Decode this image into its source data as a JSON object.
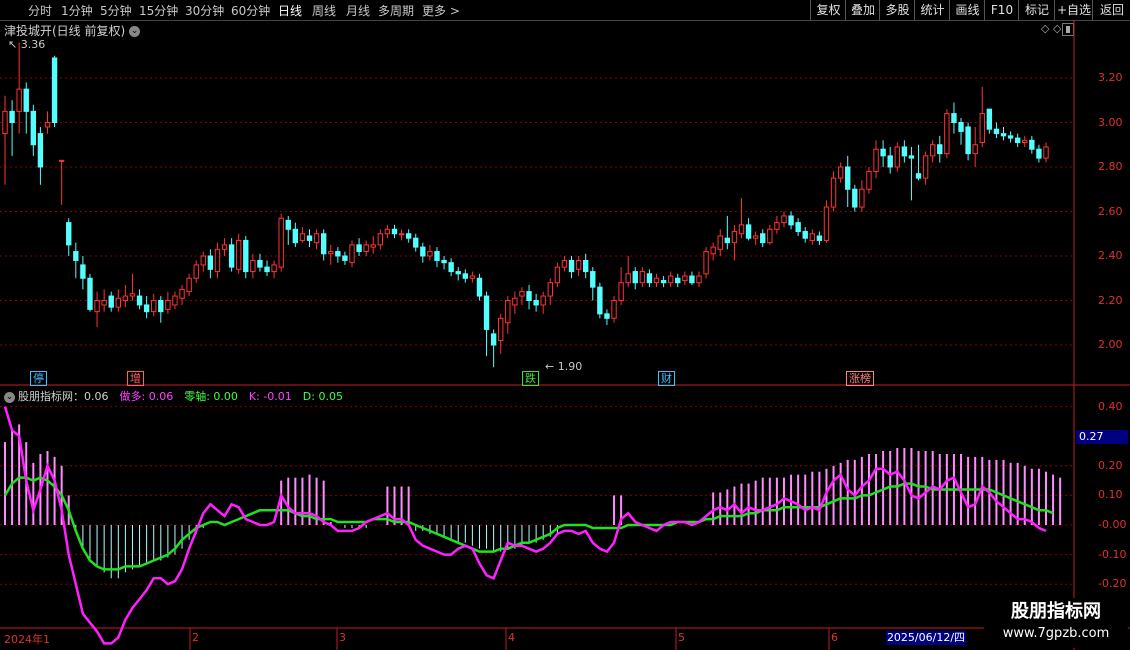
{
  "toolbar": {
    "periods": [
      "分时",
      "1分钟",
      "5分钟",
      "15分钟",
      "30分钟",
      "60分钟",
      "日线",
      "周线",
      "月线",
      "多周期",
      "更多"
    ],
    "active_index": 6,
    "more_arrow": ">",
    "buttons": [
      "复权",
      "叠加",
      "多股",
      "统计",
      "画线",
      "F10",
      "标记",
      "+自选",
      "返回"
    ]
  },
  "chart_title": "津投城开(日线 前复权)",
  "chevron": "⌄",
  "title_icons": "◇ ◇",
  "price_axis": [
    "3.20",
    "3.00",
    "2.80",
    "2.60",
    "2.40",
    "2.20",
    "2.00"
  ],
  "high_label": "3.36",
  "low_label": "1.90",
  "markers": [
    {
      "text": "停",
      "color": "#40c0ff"
    },
    {
      "text": "增",
      "color": "#ff6060"
    },
    {
      "text": "跌",
      "color": "#40e040"
    },
    {
      "text": "财",
      "color": "#40c0ff"
    },
    {
      "text": "涨榜",
      "color": "#ff8080"
    }
  ],
  "indicator": {
    "name": "股朋指标网：0.06",
    "items": [
      {
        "label": "做多: 0.06",
        "color": "#ff40ff"
      },
      {
        "label": "零轴: 0.00",
        "color": "#40ff40"
      },
      {
        "label": "K: -0.01",
        "color": "#ff40ff"
      },
      {
        "label": "D: 0.05",
        "color": "#40ff40"
      }
    ],
    "axis": [
      "0.40",
      "0.20",
      "0.10",
      "-0.00",
      "-0.10",
      "-0.20"
    ],
    "current": "0.27"
  },
  "months": [
    "2024年1",
    "2",
    "3",
    "4",
    "5",
    "6"
  ],
  "current_date": "2025/06/12/四",
  "watermark": {
    "line1": "股朋指标网",
    "line2": "www.7gpzb.com"
  },
  "colors": {
    "up": "#ff3232",
    "down": "#54ffff",
    "grid": "#8b0000",
    "k_line": "#ff20ff",
    "d_line": "#20e020"
  },
  "chart_data": {
    "type": "candlestick",
    "candles": [
      [
        2.95,
        3.05,
        3.12,
        2.72
      ],
      [
        3.05,
        3.0,
        3.1,
        2.85
      ],
      [
        3.05,
        3.15,
        3.36,
        2.95
      ],
      [
        3.15,
        3.05,
        3.18,
        2.95
      ],
      [
        3.05,
        2.9,
        3.08,
        2.85
      ],
      [
        2.95,
        2.8,
        2.98,
        2.72
      ],
      [
        2.98,
        3.0,
        3.05,
        2.95
      ],
      [
        3.29,
        3.0,
        3.3,
        2.98
      ],
      [
        2.83,
        2.83,
        2.83,
        2.63
      ],
      [
        2.55,
        2.45,
        2.57,
        2.4
      ],
      [
        2.42,
        2.38,
        2.46,
        2.3
      ],
      [
        2.36,
        2.3,
        2.4,
        2.25
      ],
      [
        2.3,
        2.16,
        2.32,
        2.15
      ],
      [
        2.15,
        2.2,
        2.24,
        2.08
      ],
      [
        2.18,
        2.2,
        2.25,
        2.15
      ],
      [
        2.22,
        2.17,
        2.24,
        2.15
      ],
      [
        2.17,
        2.21,
        2.25,
        2.15
      ],
      [
        2.2,
        2.22,
        2.27,
        2.17
      ],
      [
        2.22,
        2.23,
        2.32,
        2.2
      ],
      [
        2.22,
        2.18,
        2.25,
        2.16
      ],
      [
        2.18,
        2.15,
        2.22,
        2.12
      ],
      [
        2.15,
        2.2,
        2.23,
        2.13
      ],
      [
        2.2,
        2.15,
        2.22,
        2.1
      ],
      [
        2.16,
        2.2,
        2.24,
        2.14
      ],
      [
        2.18,
        2.22,
        2.24,
        2.16
      ],
      [
        2.21,
        2.25,
        2.27,
        2.18
      ],
      [
        2.24,
        2.3,
        2.32,
        2.22
      ],
      [
        2.3,
        2.36,
        2.38,
        2.28
      ],
      [
        2.36,
        2.4,
        2.42,
        2.33
      ],
      [
        2.4,
        2.34,
        2.43,
        2.3
      ],
      [
        2.33,
        2.43,
        2.46,
        2.3
      ],
      [
        2.43,
        2.45,
        2.48,
        2.4
      ],
      [
        2.45,
        2.35,
        2.48,
        2.33
      ],
      [
        2.34,
        2.47,
        2.5,
        2.32
      ],
      [
        2.47,
        2.33,
        2.49,
        2.3
      ],
      [
        2.33,
        2.38,
        2.41,
        2.3
      ],
      [
        2.38,
        2.35,
        2.41,
        2.33
      ],
      [
        2.35,
        2.33,
        2.38,
        2.31
      ],
      [
        2.33,
        2.36,
        2.38,
        2.3
      ],
      [
        2.35,
        2.57,
        2.59,
        2.33
      ],
      [
        2.56,
        2.52,
        2.58,
        2.45
      ],
      [
        2.52,
        2.46,
        2.55,
        2.44
      ],
      [
        2.47,
        2.5,
        2.53,
        2.46
      ],
      [
        2.49,
        2.47,
        2.52,
        2.44
      ],
      [
        2.46,
        2.5,
        2.52,
        2.43
      ],
      [
        2.5,
        2.41,
        2.52,
        2.38
      ],
      [
        2.41,
        2.42,
        2.45,
        2.36
      ],
      [
        2.42,
        2.4,
        2.44,
        2.37
      ],
      [
        2.4,
        2.38,
        2.42,
        2.36
      ],
      [
        2.37,
        2.45,
        2.47,
        2.35
      ],
      [
        2.45,
        2.42,
        2.48,
        2.4
      ],
      [
        2.42,
        2.45,
        2.47,
        2.4
      ],
      [
        2.44,
        2.45,
        2.49,
        2.41
      ],
      [
        2.45,
        2.5,
        2.52,
        2.43
      ],
      [
        2.5,
        2.52,
        2.54,
        2.48
      ],
      [
        2.52,
        2.5,
        2.54,
        2.48
      ],
      [
        2.5,
        2.5,
        2.52,
        2.47
      ],
      [
        2.5,
        2.48,
        2.52,
        2.46
      ],
      [
        2.48,
        2.44,
        2.5,
        2.42
      ],
      [
        2.44,
        2.4,
        2.46,
        2.37
      ],
      [
        2.4,
        2.42,
        2.45,
        2.38
      ],
      [
        2.42,
        2.38,
        2.44,
        2.35
      ],
      [
        2.38,
        2.37,
        2.4,
        2.34
      ],
      [
        2.37,
        2.33,
        2.39,
        2.31
      ],
      [
        2.33,
        2.32,
        2.35,
        2.29
      ],
      [
        2.32,
        2.3,
        2.34,
        2.28
      ],
      [
        2.3,
        2.31,
        2.33,
        2.28
      ],
      [
        2.3,
        2.22,
        2.32,
        2.2
      ],
      [
        2.22,
        2.07,
        2.24,
        1.95
      ],
      [
        2.05,
        2.0,
        2.07,
        1.9
      ],
      [
        2.02,
        2.12,
        2.14,
        1.96
      ],
      [
        2.1,
        2.2,
        2.22,
        2.05
      ],
      [
        2.18,
        2.21,
        2.24,
        2.14
      ],
      [
        2.22,
        2.24,
        2.26,
        2.18
      ],
      [
        2.24,
        2.2,
        2.27,
        2.16
      ],
      [
        2.2,
        2.18,
        2.23,
        2.15
      ],
      [
        2.18,
        2.22,
        2.24,
        2.14
      ],
      [
        2.22,
        2.28,
        2.3,
        2.18
      ],
      [
        2.28,
        2.35,
        2.37,
        2.26
      ],
      [
        2.35,
        2.38,
        2.4,
        2.33
      ],
      [
        2.38,
        2.33,
        2.4,
        2.3
      ],
      [
        2.34,
        2.38,
        2.4,
        2.31
      ],
      [
        2.38,
        2.33,
        2.41,
        2.3
      ],
      [
        2.33,
        2.26,
        2.35,
        2.2
      ],
      [
        2.26,
        2.14,
        2.28,
        2.12
      ],
      [
        2.14,
        2.12,
        2.16,
        2.09
      ],
      [
        2.12,
        2.2,
        2.22,
        2.1
      ],
      [
        2.2,
        2.28,
        2.35,
        2.18
      ],
      [
        2.28,
        2.32,
        2.4,
        2.26
      ],
      [
        2.33,
        2.28,
        2.35,
        2.25
      ],
      [
        2.28,
        2.33,
        2.35,
        2.26
      ],
      [
        2.32,
        2.28,
        2.34,
        2.26
      ],
      [
        2.28,
        2.3,
        2.32,
        2.26
      ],
      [
        2.29,
        2.28,
        2.31,
        2.26
      ],
      [
        2.28,
        2.31,
        2.33,
        2.26
      ],
      [
        2.3,
        2.28,
        2.32,
        2.26
      ],
      [
        2.29,
        2.31,
        2.33,
        2.27
      ],
      [
        2.31,
        2.28,
        2.33,
        2.27
      ],
      [
        2.28,
        2.31,
        2.33,
        2.26
      ],
      [
        2.32,
        2.42,
        2.44,
        2.3
      ],
      [
        2.41,
        2.44,
        2.46,
        2.38
      ],
      [
        2.43,
        2.49,
        2.52,
        2.4
      ],
      [
        2.48,
        2.46,
        2.58,
        2.43
      ],
      [
        2.46,
        2.51,
        2.54,
        2.38
      ],
      [
        2.5,
        2.54,
        2.66,
        2.48
      ],
      [
        2.54,
        2.48,
        2.57,
        2.47
      ],
      [
        2.48,
        2.49,
        2.51,
        2.45
      ],
      [
        2.5,
        2.46,
        2.52,
        2.44
      ],
      [
        2.46,
        2.52,
        2.54,
        2.45
      ],
      [
        2.52,
        2.55,
        2.58,
        2.5
      ],
      [
        2.55,
        2.58,
        2.6,
        2.53
      ],
      [
        2.58,
        2.54,
        2.6,
        2.52
      ],
      [
        2.55,
        2.51,
        2.57,
        2.49
      ],
      [
        2.51,
        2.48,
        2.53,
        2.46
      ],
      [
        2.47,
        2.5,
        2.52,
        2.45
      ],
      [
        2.49,
        2.47,
        2.51,
        2.45
      ],
      [
        2.47,
        2.62,
        2.65,
        2.46
      ],
      [
        2.62,
        2.75,
        2.78,
        2.6
      ],
      [
        2.75,
        2.8,
        2.82,
        2.73
      ],
      [
        2.8,
        2.7,
        2.85,
        2.62
      ],
      [
        2.7,
        2.62,
        2.72,
        2.6
      ],
      [
        2.62,
        2.7,
        2.74,
        2.6
      ],
      [
        2.7,
        2.78,
        2.8,
        2.68
      ],
      [
        2.78,
        2.88,
        2.92,
        2.75
      ],
      [
        2.88,
        2.85,
        2.92,
        2.8
      ],
      [
        2.85,
        2.8,
        2.89,
        2.77
      ],
      [
        2.8,
        2.89,
        2.91,
        2.78
      ],
      [
        2.89,
        2.85,
        2.92,
        2.82
      ],
      [
        2.85,
        2.84,
        2.89,
        2.65
      ],
      [
        2.77,
        2.75,
        2.9,
        2.74
      ],
      [
        2.75,
        2.85,
        2.87,
        2.72
      ],
      [
        2.85,
        2.9,
        2.92,
        2.82
      ],
      [
        2.9,
        2.86,
        2.94,
        2.82
      ],
      [
        2.86,
        3.04,
        3.06,
        2.84
      ],
      [
        3.04,
        3.0,
        3.09,
        2.95
      ],
      [
        3.0,
        2.96,
        3.02,
        2.9
      ],
      [
        2.98,
        2.86,
        3.0,
        2.83
      ],
      [
        2.86,
        2.9,
        2.98,
        2.8
      ],
      [
        2.91,
        3.04,
        3.16,
        2.89
      ],
      [
        3.06,
        2.97,
        3.06,
        2.95
      ],
      [
        2.97,
        2.95,
        3.0,
        2.93
      ],
      [
        2.95,
        2.94,
        2.98,
        2.92
      ],
      [
        2.94,
        2.93,
        2.96,
        2.91
      ],
      [
        2.93,
        2.91,
        2.95,
        2.89
      ],
      [
        2.91,
        2.92,
        2.94,
        2.89
      ],
      [
        2.92,
        2.88,
        2.94,
        2.86
      ],
      [
        2.88,
        2.84,
        2.9,
        2.82
      ],
      [
        2.84,
        2.89,
        2.91,
        2.82
      ]
    ],
    "k_line": [
      0.4,
      0.32,
      0.3,
      0.15,
      0.05,
      0.12,
      0.2,
      0.15,
      0.05,
      -0.1,
      -0.2,
      -0.3,
      -0.33,
      -0.36,
      -0.4,
      -0.4,
      -0.38,
      -0.32,
      -0.28,
      -0.25,
      -0.22,
      -0.18,
      -0.18,
      -0.2,
      -0.19,
      -0.15,
      -0.08,
      -0.02,
      0.04,
      0.07,
      0.05,
      0.03,
      0.07,
      0.06,
      0.02,
      0.01,
      0.0,
      0.0,
      0.01,
      0.1,
      0.06,
      0.04,
      0.04,
      0.04,
      0.03,
      0.01,
      0.0,
      -0.02,
      -0.02,
      -0.02,
      -0.01,
      0.01,
      0.02,
      0.03,
      0.04,
      0.02,
      0.02,
      0.0,
      -0.05,
      -0.07,
      -0.08,
      -0.09,
      -0.1,
      -0.1,
      -0.08,
      -0.07,
      -0.08,
      -0.13,
      -0.17,
      -0.18,
      -0.12,
      -0.06,
      -0.07,
      -0.07,
      -0.08,
      -0.09,
      -0.08,
      -0.06,
      -0.03,
      -0.02,
      -0.02,
      -0.03,
      -0.02,
      -0.06,
      -0.08,
      -0.09,
      -0.06,
      0.02,
      0.04,
      0.01,
      0.0,
      -0.01,
      -0.02,
      0.0,
      0.01,
      0.01,
      0.01,
      0.0,
      0.01,
      0.03,
      0.05,
      0.06,
      0.05,
      0.07,
      0.04,
      0.06,
      0.05,
      0.05,
      0.06,
      0.07,
      0.09,
      0.08,
      0.07,
      0.05,
      0.06,
      0.05,
      0.11,
      0.15,
      0.17,
      0.12,
      0.1,
      0.13,
      0.15,
      0.19,
      0.19,
      0.17,
      0.18,
      0.15,
      0.1,
      0.09,
      0.11,
      0.13,
      0.12,
      0.15,
      0.16,
      0.11,
      0.06,
      0.07,
      0.13,
      0.11,
      0.08,
      0.06,
      0.04,
      0.02,
      0.02,
      0.01,
      -0.01,
      -0.02
    ],
    "d_line": [
      0.1,
      0.14,
      0.16,
      0.16,
      0.15,
      0.16,
      0.15,
      0.13,
      0.1,
      0.05,
      -0.02,
      -0.08,
      -0.12,
      -0.14,
      -0.15,
      -0.15,
      -0.15,
      -0.14,
      -0.14,
      -0.14,
      -0.13,
      -0.12,
      -0.11,
      -0.1,
      -0.08,
      -0.05,
      -0.03,
      -0.01,
      0.0,
      0.01,
      0.01,
      0.0,
      0.01,
      0.02,
      0.03,
      0.04,
      0.05,
      0.05,
      0.05,
      0.05,
      0.05,
      0.04,
      0.03,
      0.03,
      0.02,
      0.02,
      0.02,
      0.01,
      0.01,
      0.01,
      0.01,
      0.01,
      0.02,
      0.02,
      0.02,
      0.01,
      0.01,
      0.01,
      0.0,
      -0.01,
      -0.02,
      -0.03,
      -0.04,
      -0.05,
      -0.06,
      -0.07,
      -0.08,
      -0.09,
      -0.09,
      -0.09,
      -0.08,
      -0.08,
      -0.07,
      -0.06,
      -0.06,
      -0.05,
      -0.04,
      -0.03,
      -0.01,
      0.0,
      0.0,
      0.0,
      0.0,
      -0.01,
      -0.01,
      -0.01,
      -0.01,
      -0.01,
      0.0,
      0.0,
      0.0,
      0.0,
      0.0,
      0.0,
      0.0,
      0.01,
      0.01,
      0.01,
      0.01,
      0.02,
      0.02,
      0.03,
      0.03,
      0.03,
      0.03,
      0.04,
      0.04,
      0.05,
      0.05,
      0.05,
      0.06,
      0.06,
      0.06,
      0.06,
      0.06,
      0.06,
      0.07,
      0.08,
      0.09,
      0.09,
      0.09,
      0.1,
      0.1,
      0.11,
      0.12,
      0.13,
      0.13,
      0.14,
      0.14,
      0.13,
      0.13,
      0.12,
      0.12,
      0.12,
      0.12,
      0.12,
      0.12,
      0.12,
      0.12,
      0.12,
      0.11,
      0.1,
      0.09,
      0.08,
      0.07,
      0.06,
      0.05,
      0.05,
      0.04
    ],
    "bars": [
      0.28,
      0.32,
      0.34,
      0.28,
      0.21,
      0.24,
      0.25,
      0.23,
      0.2,
      0.1,
      -0.02,
      -0.08,
      -0.12,
      -0.14,
      -0.16,
      -0.18,
      -0.18,
      -0.16,
      -0.15,
      -0.14,
      -0.13,
      -0.12,
      -0.12,
      -0.11,
      -0.1,
      -0.08,
      -0.05,
      -0.03,
      -0.01,
      0.0,
      0.0,
      0.0,
      0.0,
      0.0,
      0.0,
      0.0,
      0.0,
      0.0,
      0.0,
      0.15,
      0.16,
      0.16,
      0.16,
      0.17,
      0.16,
      0.15,
      0.01,
      0.0,
      -0.01,
      -0.01,
      -0.01,
      -0.01,
      0.0,
      0.0,
      0.13,
      0.13,
      0.13,
      0.13,
      -0.02,
      -0.02,
      -0.03,
      -0.03,
      -0.04,
      -0.05,
      -0.06,
      -0.06,
      -0.07,
      -0.08,
      -0.08,
      -0.09,
      -0.09,
      -0.08,
      -0.08,
      -0.07,
      -0.06,
      -0.06,
      -0.05,
      -0.04,
      -0.03,
      0.0,
      0.0,
      0.0,
      0.0,
      0.0,
      0.0,
      0.0,
      0.1,
      0.1,
      0.0,
      0.0,
      0.0,
      0.0,
      0.0,
      0.0,
      0.0,
      0.0,
      0.0,
      0.0,
      0.0,
      0.0,
      0.11,
      0.11,
      0.12,
      0.13,
      0.14,
      0.14,
      0.15,
      0.16,
      0.16,
      0.16,
      0.16,
      0.17,
      0.17,
      0.17,
      0.18,
      0.18,
      0.19,
      0.2,
      0.21,
      0.22,
      0.22,
      0.23,
      0.24,
      0.24,
      0.25,
      0.25,
      0.26,
      0.26,
      0.26,
      0.25,
      0.25,
      0.25,
      0.24,
      0.24,
      0.24,
      0.24,
      0.23,
      0.23,
      0.23,
      0.22,
      0.22,
      0.22,
      0.21,
      0.21,
      0.2,
      0.19,
      0.19,
      0.18,
      0.17,
      0.16
    ]
  }
}
